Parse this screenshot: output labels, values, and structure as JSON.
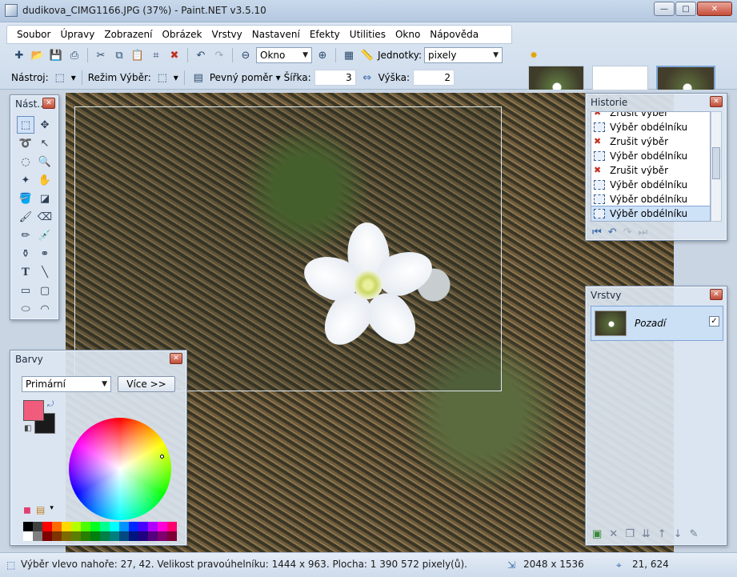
{
  "window": {
    "title": "dudikova_CIMG1166.JPG (37%) - Paint.NET v3.5.10",
    "minimize": "—",
    "maximize": "□",
    "close": "✕"
  },
  "menu": [
    {
      "label": "Soubor"
    },
    {
      "label": "Úpravy"
    },
    {
      "label": "Zobrazení"
    },
    {
      "label": "Obrázek"
    },
    {
      "label": "Vrstvy"
    },
    {
      "label": "Nastavení"
    },
    {
      "label": "Efekty"
    },
    {
      "label": "Utilities"
    },
    {
      "label": "Okno"
    },
    {
      "label": "Nápověda"
    }
  ],
  "toolbar": {
    "zoom_value": "Okno",
    "units_label": "Jednotky:",
    "units_value": "pixely"
  },
  "toolbar2": {
    "tool_label": "Nástroj:",
    "mode_label": "Režim Výběr:",
    "ratio_label": "Pevný poměr",
    "width_label": "Šířka:",
    "width_value": "3",
    "height_label": "Výška:",
    "height_value": "2"
  },
  "tools_panel": {
    "title": "Nást..."
  },
  "history_panel": {
    "title": "Historie",
    "items": [
      {
        "label": "Zrušit výběr",
        "icon": "deselect-icon"
      },
      {
        "label": "Výběr obdélníku",
        "icon": "rect-select-icon"
      },
      {
        "label": "Zrušit výběr",
        "icon": "deselect-icon"
      },
      {
        "label": "Výběr obdélníku",
        "icon": "rect-select-icon"
      },
      {
        "label": "Zrušit výběr",
        "icon": "deselect-icon"
      },
      {
        "label": "Výběr obdélníku",
        "icon": "rect-select-icon"
      },
      {
        "label": "Výběr obdélníku",
        "icon": "rect-select-icon"
      },
      {
        "label": "Výběr obdélníku",
        "icon": "rect-select-icon",
        "selected": true
      }
    ]
  },
  "layers_panel": {
    "title": "Vrstvy",
    "layer_name": "Pozadí",
    "visible": "✓"
  },
  "colors_panel": {
    "title": "Barvy",
    "mode": "Primární",
    "more_button": "Více >>",
    "primary_color": "#f25c7c",
    "secondary_color": "#1a1a1a"
  },
  "status": {
    "selection_info": "Výběr vlevo nahoře: 27, 42. Velikost pravoúhelníku: 1444 x 963. Plocha: 1 390 572 pixely(ů).",
    "image_size": "2048 x 1536",
    "cursor_pos": "21, 624"
  },
  "colors": {
    "accent": "#3a6aaa",
    "selection": "#cde1f7"
  }
}
